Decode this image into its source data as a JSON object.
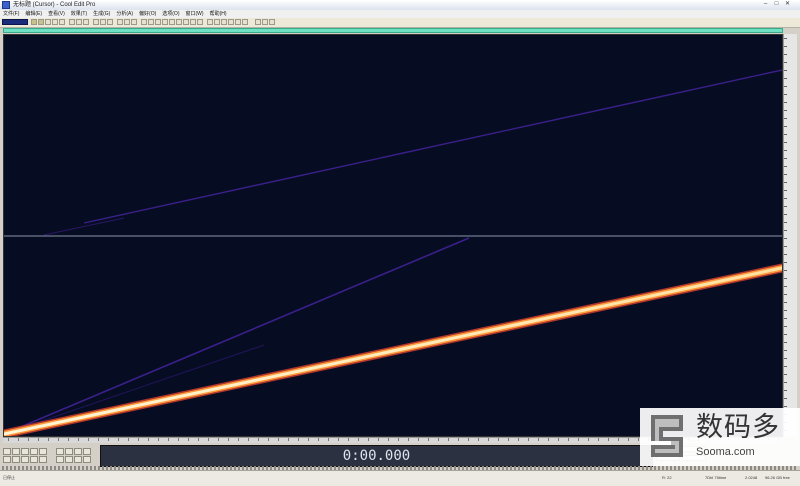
{
  "window": {
    "title": "无标题 (Cursor) - Cool Edit Pro",
    "min_glyph": "–",
    "max_glyph": "□",
    "close_glyph": "✕"
  },
  "menu": [
    "文件(F)",
    "编辑(E)",
    "查看(V)",
    "效果(T)",
    "生成(G)",
    "分析(A)",
    "偏好(O)",
    "选项(O)",
    "窗口(W)",
    "帮助(H)"
  ],
  "spectral_view": {
    "background": "#060d22",
    "harmonic_color": "#3a1f8a",
    "fundamental_color": "#ffe8b0"
  },
  "transport": {
    "time": "0:00.000"
  },
  "status": {
    "left": "已停止",
    "fields": [
      "R: 22",
      "7Dbl 75time",
      "2.0248",
      "96.26 GB free"
    ]
  },
  "watermark": {
    "cn": "数码多",
    "en": "Sooma.com"
  },
  "icons": {
    "app": "app-icon",
    "logo": "sooma-logo-icon"
  }
}
